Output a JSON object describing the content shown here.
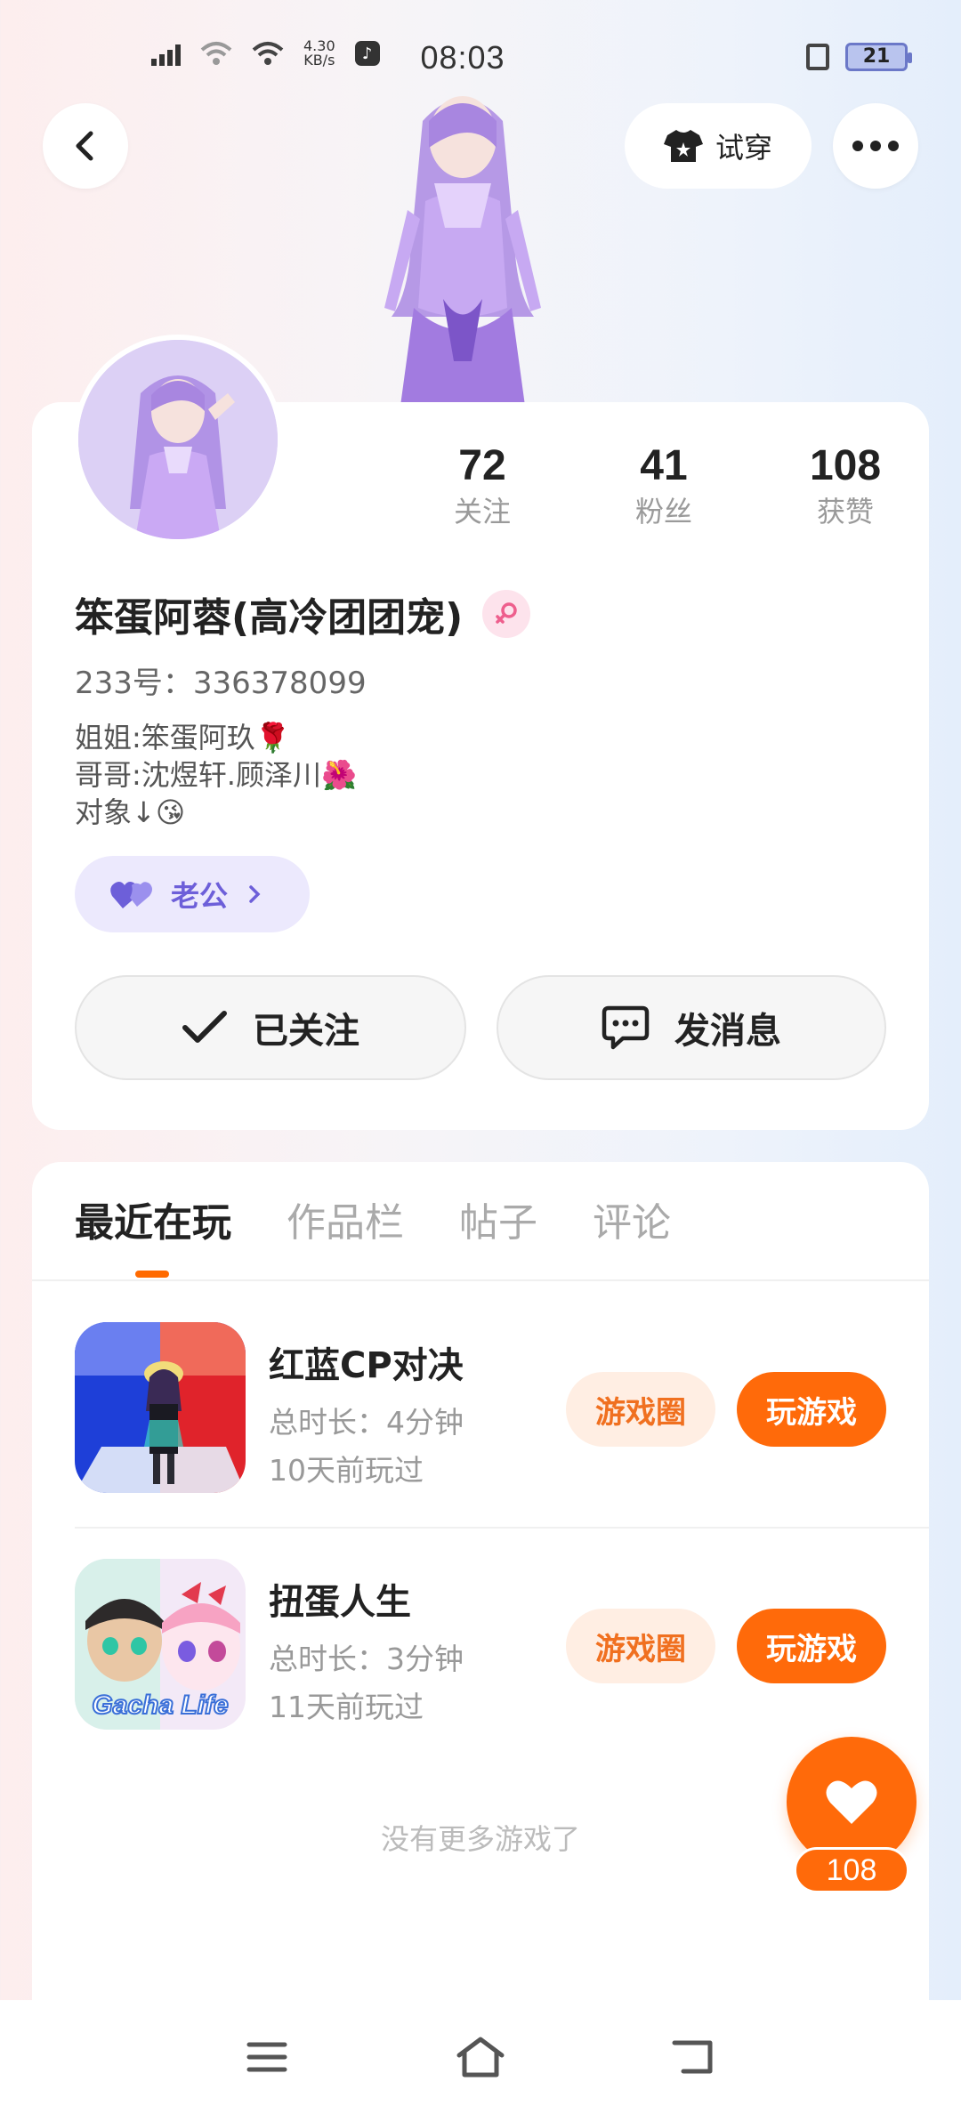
{
  "status_bar": {
    "network_speed": "4.30",
    "network_speed_unit": "KB/s",
    "time": "08:03",
    "battery": "21"
  },
  "header": {
    "tryon_label": "试穿"
  },
  "profile": {
    "stats": [
      {
        "value": "72",
        "label": "关注"
      },
      {
        "value": "41",
        "label": "粉丝"
      },
      {
        "value": "108",
        "label": "获赞"
      }
    ],
    "nickname": "笨蛋阿蓉(高冷团团宠)",
    "uid": "233号：336378099",
    "bio_lines": [
      "姐姐:笨蛋阿玖🌹",
      "哥哥:沈煜轩.顾泽川🌺",
      "对象↓😘"
    ],
    "relation_label": "老公",
    "follow_label": "已关注",
    "message_label": "发消息"
  },
  "tabs": [
    {
      "label": "最近在玩",
      "active": true
    },
    {
      "label": "作品栏",
      "active": false
    },
    {
      "label": "帖子",
      "active": false
    },
    {
      "label": "评论",
      "active": false
    }
  ],
  "games": [
    {
      "title": "红蓝CP对决",
      "duration": "总时长：4分钟",
      "last_played": "10天前玩过",
      "circle_label": "游戏圈",
      "play_label": "玩游戏"
    },
    {
      "title": "扭蛋人生",
      "duration": "总时长：3分钟",
      "last_played": "11天前玩过",
      "circle_label": "游戏圈",
      "play_label": "玩游戏",
      "icon_text": "Gacha Life"
    }
  ],
  "no_more_text": "没有更多游戏了",
  "like_count": "108",
  "colors": {
    "accent": "#ff6a0a",
    "relation": "#6d5fd9",
    "avatar_bg": "#dcd0f5"
  }
}
